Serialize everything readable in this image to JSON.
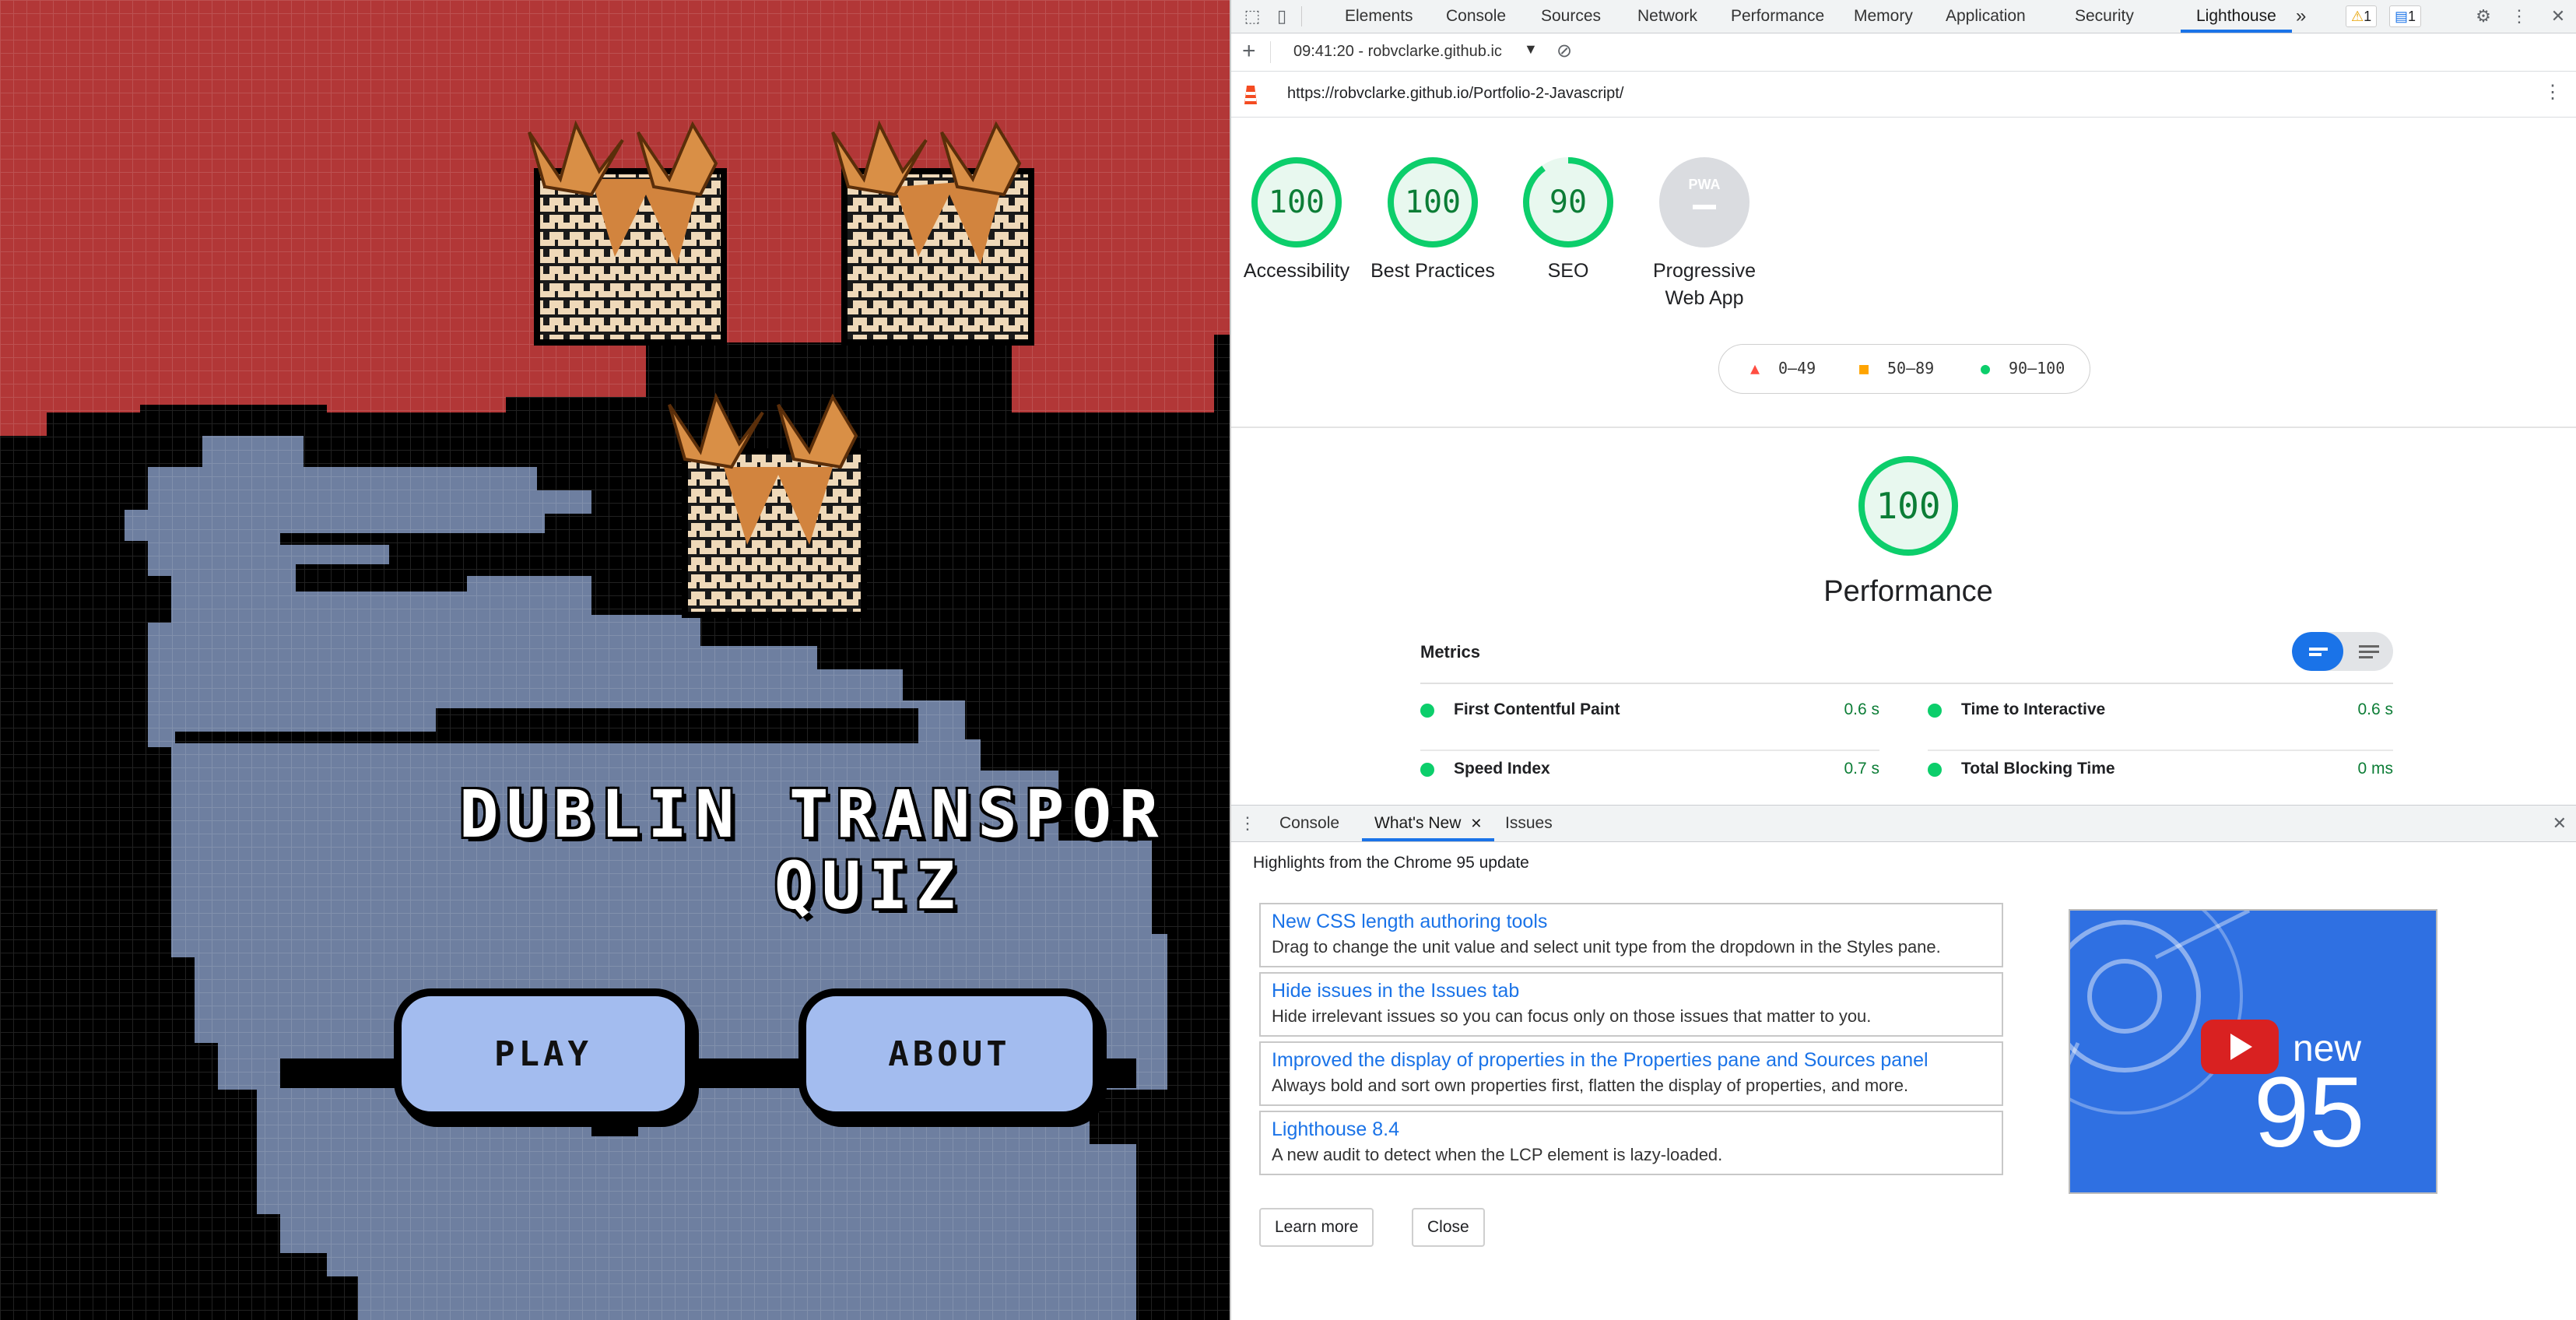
{
  "game": {
    "title_line1": "DUBLIN TRANSPOR",
    "title_line2": "QUIZ",
    "play_label": "PLAY",
    "about_label": "ABOUT"
  },
  "devtools": {
    "tabs": [
      "Elements",
      "Console",
      "Sources",
      "Network",
      "Performance",
      "Memory",
      "Application",
      "Security",
      "Lighthouse"
    ],
    "active_tab": "Lighthouse",
    "more_tabs": "»",
    "warnings_count": "1",
    "messages_count": "1",
    "report_selector": "09:41:20 - robvclarke.github.ic",
    "url": "https://robvclarke.github.io/Portfolio-2-Javascript/",
    "categories": [
      {
        "score": "100",
        "label": "Performance",
        "value": 100
      },
      {
        "score": "100",
        "label": "Accessibility",
        "value": 100
      },
      {
        "score": "100",
        "label": "Best Practices",
        "value": 100
      },
      {
        "score": "90",
        "label": "SEO",
        "value": 90
      },
      {
        "score": "",
        "label": "Progressive Web App",
        "badge": "PWA"
      }
    ],
    "legend": {
      "fail": "0–49",
      "average": "50–89",
      "pass": "90–100"
    },
    "performance": {
      "score": "100",
      "title": "Performance",
      "metrics_heading": "Metrics",
      "metrics": [
        {
          "name": "First Contentful Paint",
          "value": "0.6 s"
        },
        {
          "name": "Time to Interactive",
          "value": "0.6 s"
        },
        {
          "name": "Speed Index",
          "value": "0.7 s"
        },
        {
          "name": "Total Blocking Time",
          "value": "0 ms"
        }
      ]
    },
    "drawer": {
      "tabs": [
        "Console",
        "What's New",
        "Issues"
      ],
      "active_tab": "What's New",
      "highlights": "Highlights from the Chrome 95 update",
      "items": [
        {
          "title": "New CSS length authoring tools",
          "desc": "Drag to change the unit value and select unit type from the dropdown in the Styles pane."
        },
        {
          "title": "Hide issues in the Issues tab",
          "desc": "Hide irrelevant issues so you can focus only on those issues that matter to you."
        },
        {
          "title": "Improved the display of properties in the Properties pane and Sources panel",
          "desc": "Always bold and sort own properties first, flatten the display of properties, and more."
        },
        {
          "title": "Lighthouse 8.4",
          "desc": "A new audit to detect when the LCP element is lazy-loaded."
        }
      ],
      "learn_more": "Learn more",
      "close": "Close",
      "video_text_new": "new",
      "video_text_version": "95"
    },
    "colors": {
      "pass": "#0cce6b",
      "average": "#ffa400",
      "fail": "#ff4e42",
      "accent": "#1a73e8"
    }
  }
}
